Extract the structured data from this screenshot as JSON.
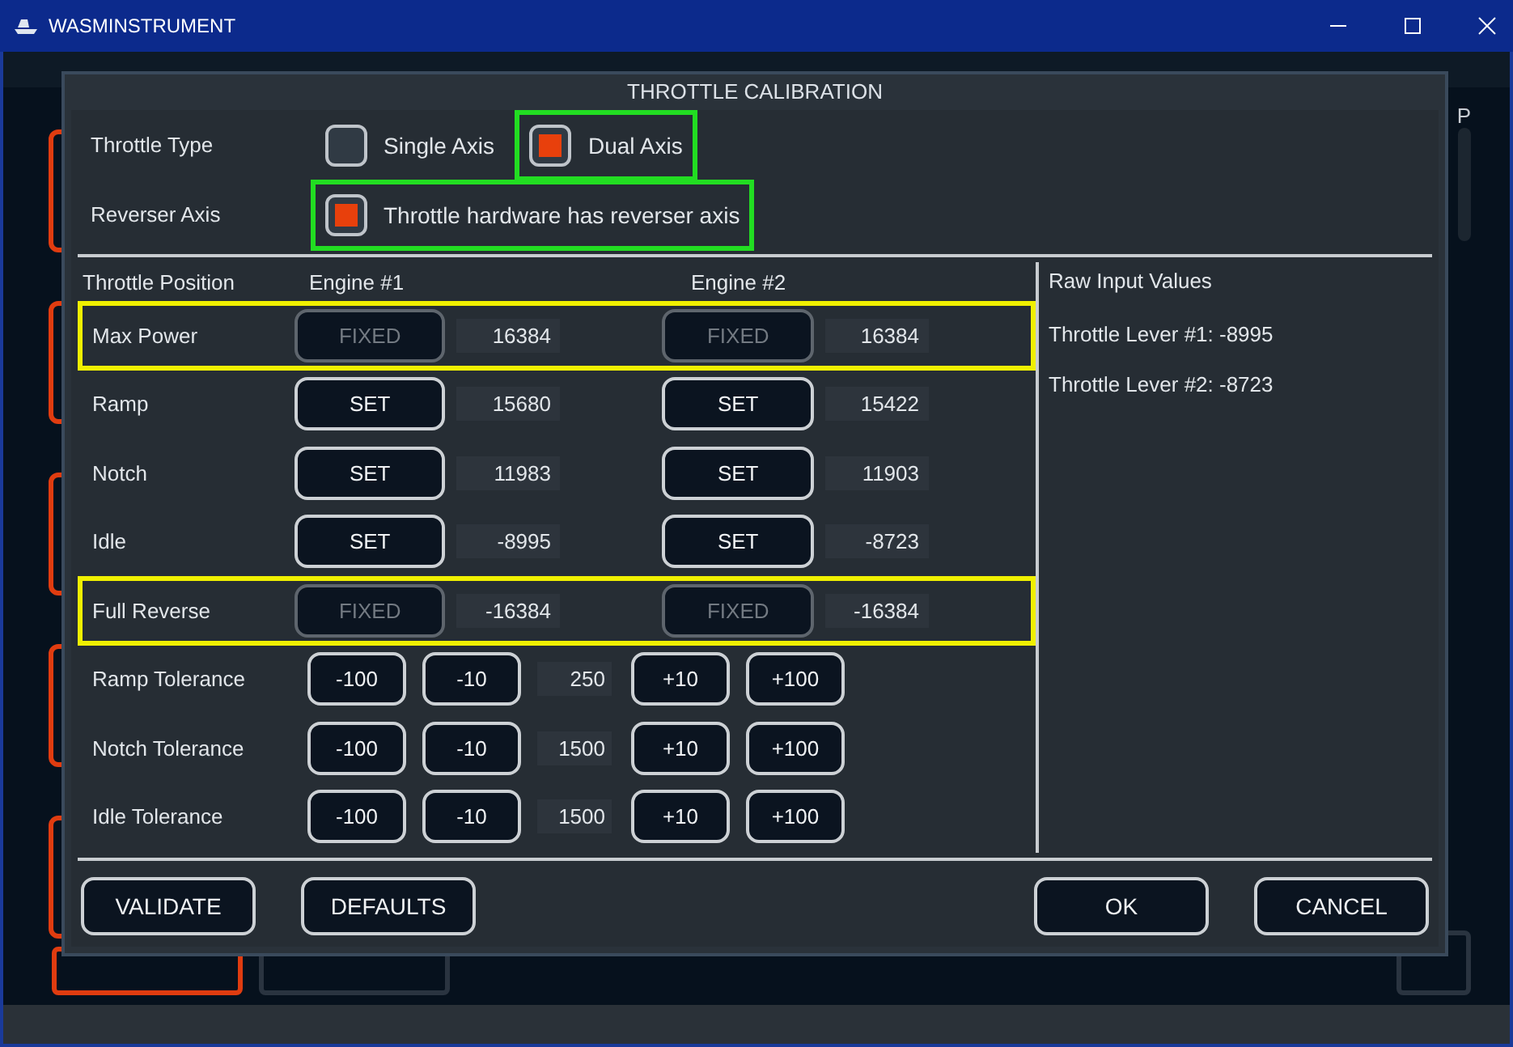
{
  "window": {
    "title": "WASMINSTRUMENT"
  },
  "background_right_label": "P",
  "dialog": {
    "title": "THROTTLE CALIBRATION",
    "throttle_type": {
      "label": "Throttle Type",
      "options": [
        {
          "label": "Single Axis",
          "selected": false,
          "highlighted": false
        },
        {
          "label": "Dual Axis",
          "selected": true,
          "highlighted": true
        }
      ]
    },
    "reverser": {
      "label": "Reverser Axis",
      "option": "Throttle hardware has reverser axis",
      "checked": true,
      "highlighted": true
    },
    "columns": [
      "Throttle Position",
      "Engine #1",
      "Engine #2"
    ],
    "positions": [
      {
        "label": "Max Power",
        "kind": "fixed",
        "highlighted": true,
        "engines": [
          {
            "button": "FIXED",
            "value": "16384"
          },
          {
            "button": "FIXED",
            "value": "16384"
          }
        ]
      },
      {
        "label": "Ramp",
        "kind": "set",
        "highlighted": false,
        "engines": [
          {
            "button": "SET",
            "value": "15680"
          },
          {
            "button": "SET",
            "value": "15422"
          }
        ]
      },
      {
        "label": "Notch",
        "kind": "set",
        "highlighted": false,
        "engines": [
          {
            "button": "SET",
            "value": "11983"
          },
          {
            "button": "SET",
            "value": "11903"
          }
        ]
      },
      {
        "label": "Idle",
        "kind": "set",
        "highlighted": false,
        "engines": [
          {
            "button": "SET",
            "value": "-8995"
          },
          {
            "button": "SET",
            "value": "-8723"
          }
        ]
      },
      {
        "label": "Full Reverse",
        "kind": "fixed",
        "highlighted": true,
        "engines": [
          {
            "button": "FIXED",
            "value": "-16384"
          },
          {
            "button": "FIXED",
            "value": "-16384"
          }
        ]
      }
    ],
    "tolerances": [
      {
        "label": "Ramp Tolerance",
        "buttons": [
          "-100",
          "-10",
          "+10",
          "+100"
        ],
        "value": "250"
      },
      {
        "label": "Notch Tolerance",
        "buttons": [
          "-100",
          "-10",
          "+10",
          "+100"
        ],
        "value": "1500"
      },
      {
        "label": "Idle Tolerance",
        "buttons": [
          "-100",
          "-10",
          "+10",
          "+100"
        ],
        "value": "1500"
      }
    ],
    "raw_input": {
      "title": "Raw Input Values",
      "lines": [
        "Throttle Lever #1: -8995",
        "Throttle Lever #2: -8723"
      ]
    },
    "left_buttons": [
      "VALIDATE",
      "DEFAULTS"
    ],
    "right_buttons": [
      "OK",
      "CANCEL"
    ]
  }
}
